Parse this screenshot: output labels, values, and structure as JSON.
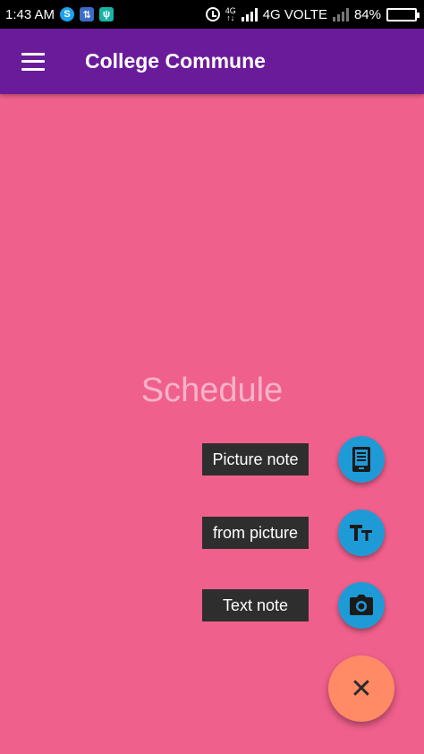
{
  "status_bar": {
    "time": "1:43 AM",
    "network_small_top": "4G",
    "network_small_bottom": "↑↓",
    "network": "4G VOLTE",
    "battery": "84%",
    "battery_level": 0.84
  },
  "app_bar": {
    "title": "College Commune",
    "menu_icon": "hamburger-menu-icon"
  },
  "content": {
    "heading": "Schedule"
  },
  "fab_menu": {
    "items": [
      {
        "label": "Picture note",
        "icon": "tablet-document-icon"
      },
      {
        "label": "from picture",
        "icon": "text-format-icon",
        "icon_text": "TT"
      },
      {
        "label": "Text note",
        "icon": "camera-icon"
      }
    ],
    "close_icon": "close-icon",
    "close_glyph": "✕"
  },
  "colors": {
    "background": "#f0608c",
    "app_bar": "#6a1b9a",
    "mini_fab": "#1e9bd7",
    "main_fab": "#ff8a65",
    "label_bg": "#2e2e2e"
  }
}
